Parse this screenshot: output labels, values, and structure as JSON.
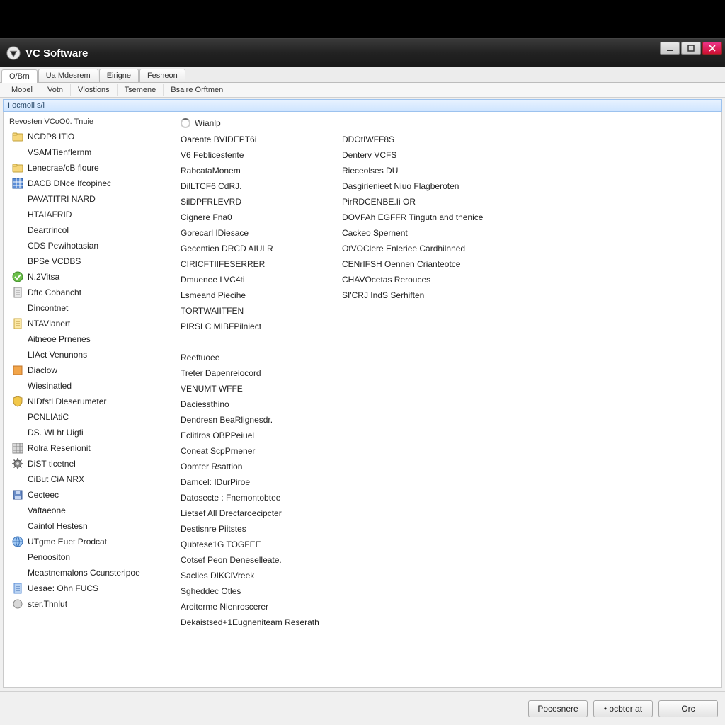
{
  "title": "VC Software",
  "tabs": {
    "t0": "O/Brn",
    "t1": "Ua Mdesrem",
    "t2": "Eirigne",
    "t3": "Fesheon"
  },
  "modules": {
    "m0": "Mobel",
    "m1": "Votn",
    "m2": "Vlostions",
    "m3": "Tsemene",
    "m4": "Bsaire Orftmen"
  },
  "section_header": "I ocmoll s/i",
  "tree_title": "Revosten VCoO0. Tnuie",
  "mid_header": "Wianlp",
  "tree": [
    {
      "icon": "folder-yellow",
      "label": "NCDP8 ITiO"
    },
    {
      "icon": "none",
      "label": "VSAMTienflernm"
    },
    {
      "icon": "folder-yellow",
      "label": "Lenecrae/cB fioure"
    },
    {
      "icon": "grid-blue",
      "label": "DACB DNce Ifcopinec"
    },
    {
      "icon": "none",
      "label": "PAVATITRI NARD"
    },
    {
      "icon": "none",
      "label": "HTAIAFRID"
    },
    {
      "icon": "none",
      "label": "Deartrincol"
    },
    {
      "icon": "none",
      "label": "CDS Pewihotasian"
    },
    {
      "icon": "none",
      "label": "BPSe VCDBS"
    },
    {
      "icon": "check-green",
      "label": "N.2Vitsa"
    },
    {
      "icon": "doc-grey",
      "label": "Dftc Cobancht"
    },
    {
      "icon": "none",
      "label": "Dincontnet"
    },
    {
      "icon": "doc-yellow",
      "label": "NTAVlanert"
    },
    {
      "icon": "none",
      "label": "Aitneoe Prnenes"
    },
    {
      "icon": "none",
      "label": "LIAct Venunons"
    },
    {
      "icon": "box-orange",
      "label": "Diaclow"
    },
    {
      "icon": "none",
      "label": "Wiesinatled"
    },
    {
      "icon": "shield",
      "label": "NIDfstl Dleserumeter"
    },
    {
      "icon": "none",
      "label": "PCNLIAtiC"
    },
    {
      "icon": "none",
      "label": "DS. WLht Uigfi"
    },
    {
      "icon": "grid-grey",
      "label": "Rolra Resenionit"
    },
    {
      "icon": "gear",
      "label": "DiST ticetnel"
    },
    {
      "icon": "none",
      "label": "CiBut CiA NRX"
    },
    {
      "icon": "disk",
      "label": "Cecteec"
    },
    {
      "icon": "none",
      "label": "Vaftaeone"
    },
    {
      "icon": "none",
      "label": "Caintol Hestesn"
    },
    {
      "icon": "globe",
      "label": "UTgme Euet Prodcat"
    },
    {
      "icon": "none",
      "label": "Penoositon"
    },
    {
      "icon": "none",
      "label": "Meastnemalons Ccunsteripoe"
    },
    {
      "icon": "doc-blue",
      "label": "Uesae: Ohn FUCS"
    },
    {
      "icon": "circle",
      "label": "ster.Thnlut"
    }
  ],
  "mid": [
    "Oarente BVIDEPT6i",
    "V6 Feblicestente",
    "RabcataMonem",
    "DilLTCF6 CdRJ.",
    "SilDPFRLEVRD",
    "Cignere Fna0",
    "Gorecarl IDiesace",
    "Gecentien DRCD AIULR",
    "CIRICFTIIFESERRER",
    "Dmuenee LVC4ti",
    "Lsmeand Piecihe",
    "TORTWAIITFEN",
    "PIRSLC MIBFPilniect",
    "",
    "Reeftuoee",
    "Treter Dapenreiocord",
    "VENUMT WFFE",
    "Daciessthino",
    "Dendresn BeaRlignesdr.",
    "Eclitlros OBPPeiuel",
    "Coneat ScpPrnener",
    "Oomter Rsattion",
    "Damcel: IDurPiroe",
    "Datosecte : Fnemontobtee",
    "Lietsef All Drectaroecipcter",
    "Destisnre Piitstes",
    "Qubtese1G TOGFEE",
    "Cotsef Peon Deneselleate.",
    "Saclies DIKClVreek",
    "Sgheddec Otles",
    "Aroiterme Nienroscerer",
    "Dekaistsed+1Eugneniteam Reserath"
  ],
  "right": [
    "DDOtIWFF8S",
    "Denterv VCFS",
    "Rieceolses DU",
    "Dasgirienieet Niuo Flagberoten",
    "PirRDCENBE.Ii OR",
    "DOVFAh EGFFR Tingutn and tnenice",
    "Cackeo Spernent",
    "OtVOClere Enleriee Cardhilnned",
    "CENrIFSH Oennen Crianteotce",
    "CHAVOcetas Rerouces",
    "SI'CRJ IndS Serhiften"
  ],
  "buttons": {
    "b0": "Pocesnere",
    "b1": "• ocbter at",
    "b2": "Orc"
  }
}
